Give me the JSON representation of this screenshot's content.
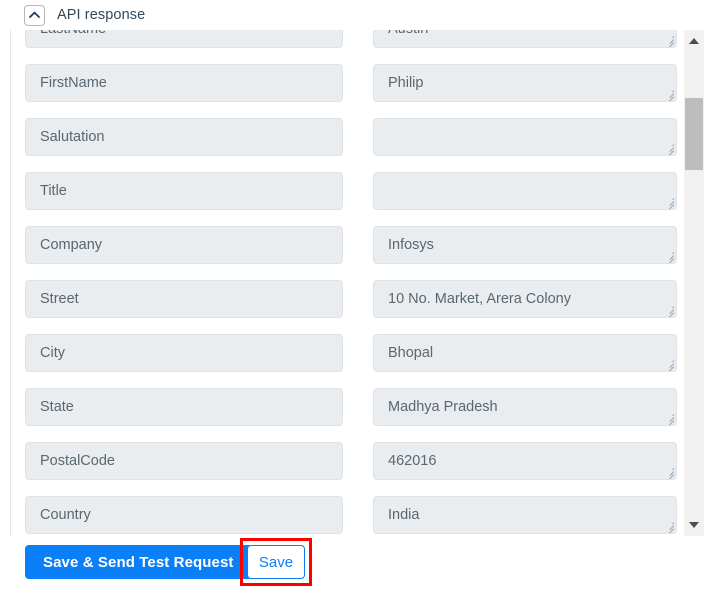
{
  "header": {
    "title": "API response",
    "collapse_icon": "chevron-up-icon"
  },
  "scrollbar": {
    "up_icon": "triangle-up-icon",
    "down_icon": "triangle-down-icon"
  },
  "mapping_rows": [
    {
      "property": "LastName",
      "value": "Austin"
    },
    {
      "property": "FirstName",
      "value": "Philip"
    },
    {
      "property": "Salutation",
      "value": ""
    },
    {
      "property": "Title",
      "value": ""
    },
    {
      "property": "Company",
      "value": "Infosys"
    },
    {
      "property": "Street",
      "value": "10 No. Market, Arera Colony"
    },
    {
      "property": "City",
      "value": "Bhopal"
    },
    {
      "property": "State",
      "value": "Madhya Pradesh"
    },
    {
      "property": "PostalCode",
      "value": "462016"
    },
    {
      "property": "Country",
      "value": "India"
    }
  ],
  "footer": {
    "primary_label": "Save & Send Test Request",
    "secondary_label": "Save"
  },
  "colors": {
    "accent_blue": "#0b7ff5",
    "field_bg": "#e9edf0",
    "highlight_red": "#ff0000",
    "title_text": "#33475b"
  }
}
